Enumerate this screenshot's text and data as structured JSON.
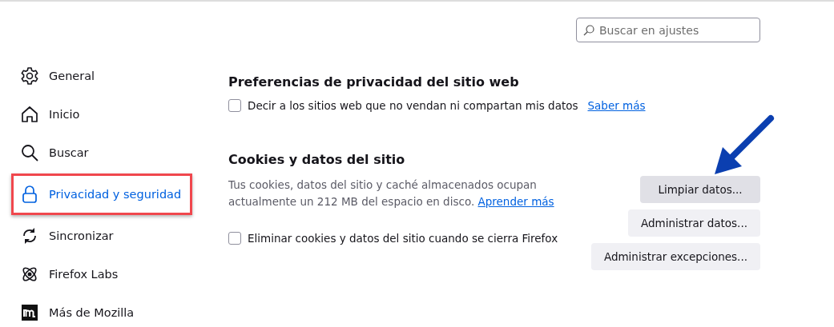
{
  "search": {
    "placeholder": "Buscar en ajustes"
  },
  "sidebar": {
    "items": [
      {
        "label": "General",
        "selected": false
      },
      {
        "label": "Inicio",
        "selected": false
      },
      {
        "label": "Buscar",
        "selected": false
      },
      {
        "label": "Privacidad y seguridad",
        "selected": true
      },
      {
        "label": "Sincronizar",
        "selected": false
      },
      {
        "label": "Firefox Labs",
        "selected": false
      },
      {
        "label": "Más de Mozilla",
        "selected": false
      }
    ]
  },
  "sections": [
    {
      "title": "Preferencias de privacidad del sitio web",
      "checkbox": {
        "label": "Decir a los sitios web que no vendan ni compartan mis datos",
        "checked": false,
        "link": "Saber más"
      }
    },
    {
      "title": "Cookies y datos del sitio",
      "description": "Tus cookies, datos del sitio y caché almacenados ocupan actualmente un 212 MB del espacio en disco.",
      "link": "Aprender más",
      "buttons": [
        {
          "label": "Limpiar datos...",
          "highlighted": true
        },
        {
          "label": "Administrar datos...",
          "highlighted": false
        }
      ],
      "checkbox": {
        "label": "Eliminar cookies y datos del sitio cuando se cierra Firefox",
        "checked": false
      },
      "extra_button": "Administrar excepciones..."
    }
  ]
}
